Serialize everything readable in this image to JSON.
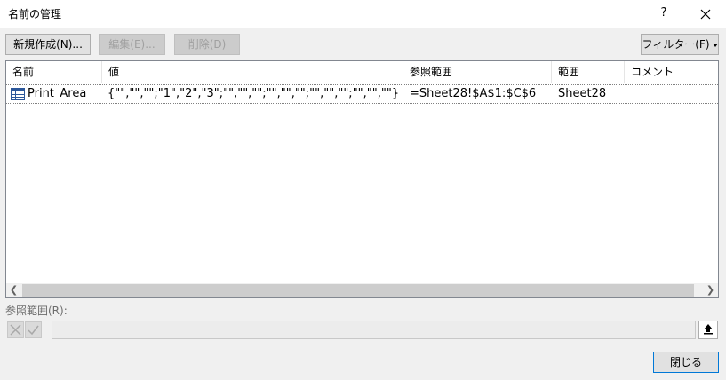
{
  "window": {
    "title": "名前の管理",
    "help_label": "?"
  },
  "toolbar": {
    "new_label": "新規作成(N)...",
    "edit_label": "編集(E)...",
    "delete_label": "削除(D)",
    "filter_label": "フィルター(F)"
  },
  "list": {
    "columns": [
      "名前",
      "値",
      "参照範囲",
      "範囲",
      "コメント"
    ],
    "rows": [
      {
        "icon": "table-grid-icon",
        "name": "Print_Area",
        "value": "{\"\",\"\",\"\";\"1\",\"2\",\"3\";\"\",\"\",\"\";\"\",\"\",\"\";\"\",\"\",\"\";\"\",\"\",\"\"}",
        "refers_to": "=Sheet28!$A$1:$C$6",
        "scope": "Sheet28",
        "comment": ""
      }
    ]
  },
  "reference": {
    "label": "参照範囲(R):",
    "value": ""
  },
  "footer": {
    "close_label": "閉じる"
  }
}
